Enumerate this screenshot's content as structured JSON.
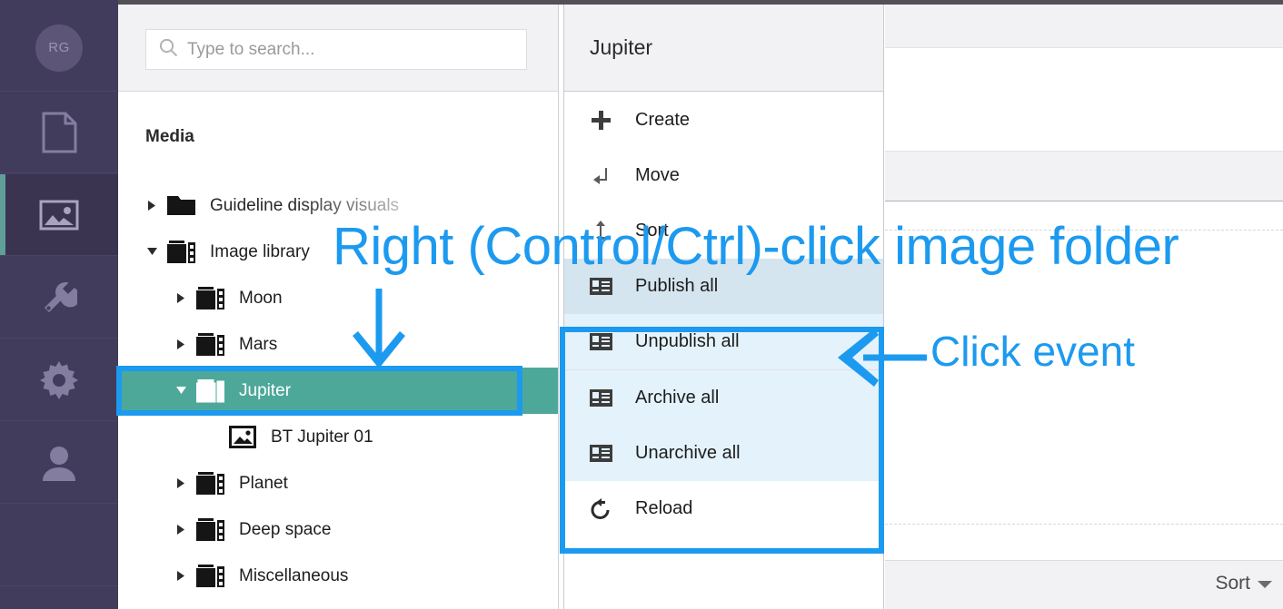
{
  "rail": {
    "avatar_initials": "RG",
    "items": [
      {
        "name": "documents",
        "icon": "document-icon"
      },
      {
        "name": "media",
        "icon": "image-icon",
        "active": true
      },
      {
        "name": "tools",
        "icon": "wrench-icon"
      },
      {
        "name": "settings",
        "icon": "gear-icon"
      },
      {
        "name": "user",
        "icon": "person-icon"
      }
    ]
  },
  "tree_panel": {
    "search": {
      "placeholder": "Type to search...",
      "value": "",
      "icon": "search-icon"
    },
    "title": "Media",
    "items": [
      {
        "label": "Guideline display visuals",
        "indent": 0,
        "expanded": false,
        "icon": "folder-icon",
        "faded": true
      },
      {
        "label": "Image library",
        "indent": 0,
        "expanded": true,
        "icon": "media-folder-icon"
      },
      {
        "label": "Moon",
        "indent": 1,
        "expanded": false,
        "icon": "media-folder-icon"
      },
      {
        "label": "Mars",
        "indent": 1,
        "expanded": false,
        "icon": "media-folder-icon"
      },
      {
        "label": "Jupiter",
        "indent": 1,
        "expanded": true,
        "icon": "media-folder-icon",
        "selected": true
      },
      {
        "label": "BT Jupiter 01",
        "indent": 2,
        "expanded": null,
        "icon": "image-file-icon"
      },
      {
        "label": "Planet",
        "indent": 1,
        "expanded": false,
        "icon": "media-folder-icon"
      },
      {
        "label": "Deep space",
        "indent": 1,
        "expanded": false,
        "icon": "media-folder-icon"
      },
      {
        "label": "Miscellaneous",
        "indent": 1,
        "expanded": false,
        "icon": "media-folder-icon"
      }
    ]
  },
  "context_menu": {
    "title": "Jupiter",
    "items": [
      {
        "label": "Create",
        "icon": "plus-icon",
        "highlighted": false,
        "hover": false
      },
      {
        "label": "Move",
        "icon": "move-arrow-icon",
        "highlighted": false,
        "hover": false
      },
      {
        "label": "Sort",
        "icon": "sort-updown-icon",
        "highlighted": false,
        "hover": false
      },
      {
        "label": "Publish all",
        "icon": "card-icon",
        "highlighted": true,
        "hover": true
      },
      {
        "label": "Unpublish all",
        "icon": "card-icon",
        "highlighted": true,
        "hover": false
      },
      {
        "label": "Archive all",
        "icon": "card-icon",
        "highlighted": true,
        "hover": false
      },
      {
        "label": "Unarchive all",
        "icon": "card-icon",
        "highlighted": true,
        "hover": false
      },
      {
        "label": "Reload",
        "icon": "reload-icon",
        "highlighted": false,
        "hover": false
      }
    ]
  },
  "content_panel": {
    "sort_label": "Sort",
    "sort_caret_icon": "caret-down-icon"
  },
  "annotations": {
    "callout_1": "Right (Control/Ctrl)-click image folder",
    "callout_2": "Click event",
    "color": "#1c9aef",
    "arrow_down": "arrow-down-annotation",
    "arrow_left": "arrow-left-annotation"
  },
  "colors": {
    "rail_bg": "#423c5c",
    "selection_green": "#4ea89a",
    "annotation_blue": "#1c9aef",
    "menu_highlight": "#e3f2fb",
    "menu_hover": "#d5e5ef"
  }
}
